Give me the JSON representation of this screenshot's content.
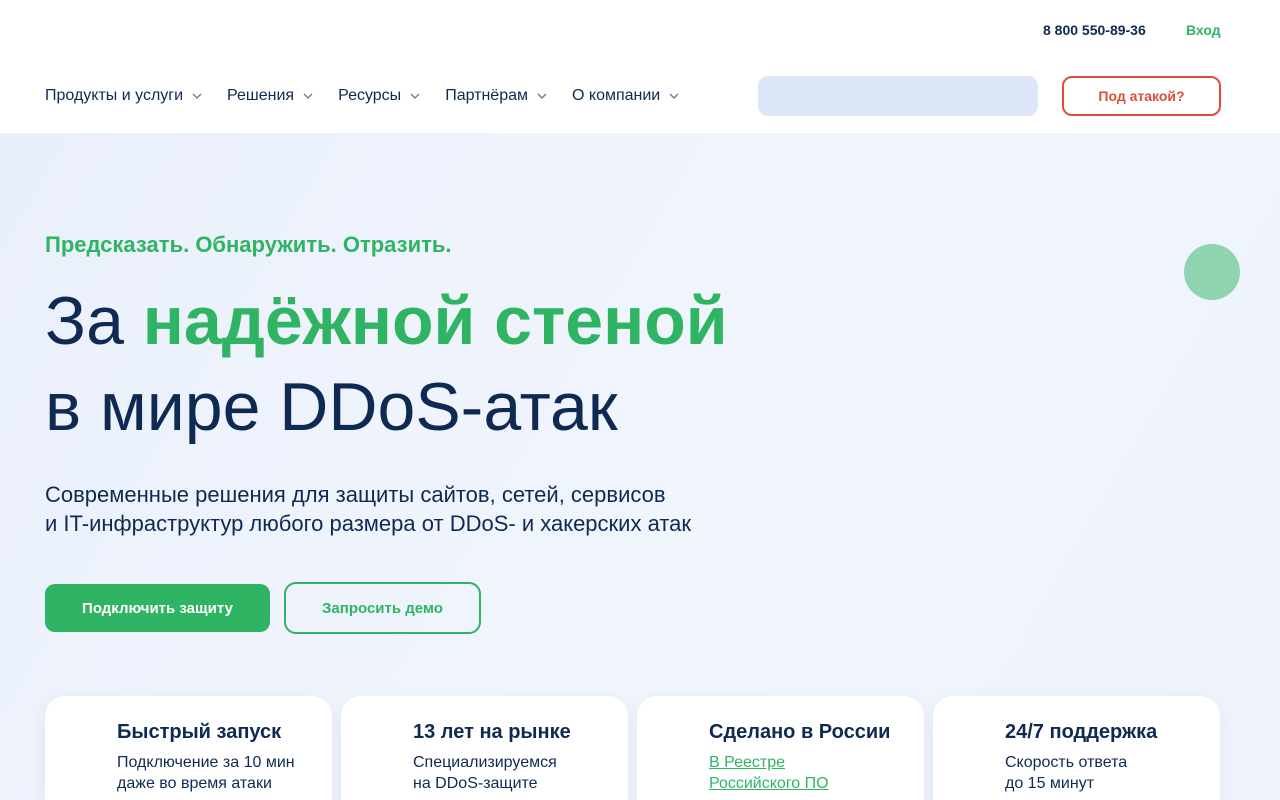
{
  "header": {
    "phone": "8 800 550-89-36",
    "login_label": "Вход",
    "nav": [
      {
        "label": "Продукты и услуги"
      },
      {
        "label": "Решения"
      },
      {
        "label": "Ресурсы"
      },
      {
        "label": "Партнёрам"
      },
      {
        "label": "О компании"
      }
    ],
    "search_placeholder": "",
    "attack_button": "Под атакой?"
  },
  "hero": {
    "tagline": "Предсказать. Обнаружить. Отразить.",
    "headline_prefix": "За ",
    "headline_accent": "надёжной стеной",
    "headline_line2": "в мире DDoS-атак",
    "subtitle_line1": "Современные решения для защиты сайтов, сетей, сервисов",
    "subtitle_line2": "и IT-инфраструктур любого размера от DDoS- и хакерских атак",
    "primary_button": "Подключить защиту",
    "secondary_button": "Запросить демо"
  },
  "features": [
    {
      "title": "Быстрый запуск",
      "line1": "Подключение за 10 мин",
      "line2": "даже во время атаки"
    },
    {
      "title": "13 лет на рынке",
      "line1": "Специализируемся",
      "line2": "на DDoS-защите"
    },
    {
      "title": "Сделано в России",
      "link1": "В Реестре",
      "link2": "Российского ПО"
    },
    {
      "title": "24/7 поддержка",
      "line1": "Скорость ответа",
      "line2": "до 15 минут"
    }
  ],
  "colors": {
    "brand_green": "#2fb463",
    "navy_text": "#0f2a52",
    "alert_red": "#d9503a",
    "hero_bg": "#eef3fb"
  },
  "icons": {
    "nav_dropdown": "chevron-down-icon",
    "chat": "chat-bubble-icon"
  }
}
